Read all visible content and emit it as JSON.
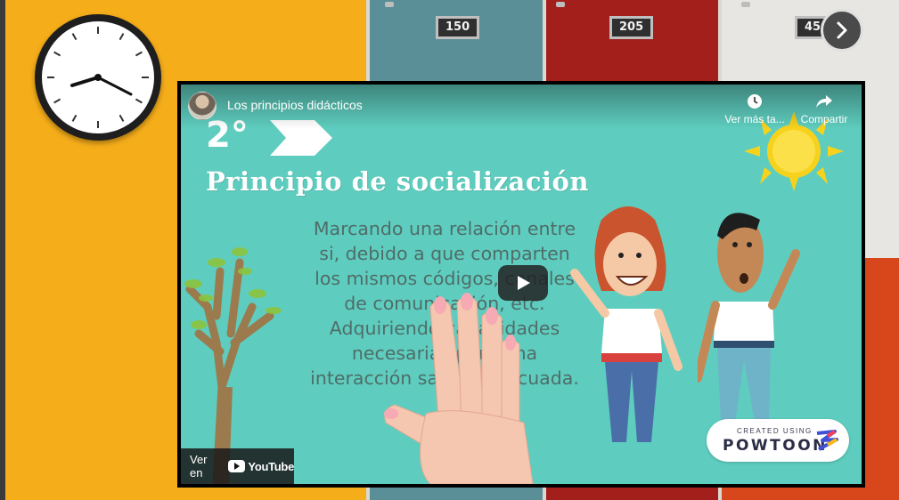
{
  "background": {
    "door_numbers": [
      "150",
      "205",
      "450"
    ],
    "colors": {
      "yellow": "#f5ad1a",
      "teal": "#5b8f98",
      "red": "#a31f1c",
      "orange": "#d8461c"
    }
  },
  "clock": {
    "icon": "wall-clock-icon",
    "time": "8:20"
  },
  "navigation": {
    "next_icon": "chevron-right-icon"
  },
  "video": {
    "title": "Los principios didácticos",
    "actions": {
      "watch_later": "Ver más ta...",
      "share": "Compartir"
    },
    "slide": {
      "number": "2°",
      "heading": "Principio de socialización",
      "body_lines": [
        "Marcando una relación entre",
        "si, debido a que comparten",
        "los mismos códigos, canales",
        "de comunicación, etc.",
        "Adquiriendo capacidades",
        "necesarias para una",
        "interacción sana y adecuada."
      ]
    },
    "watermark": {
      "created_using": "CREATED USING",
      "brand": "POWTOON"
    },
    "watch_on": {
      "label": "Ver en",
      "logo_text": "YouTube"
    },
    "colors": {
      "slide_bg": "#5ecdbf",
      "sun": "#f7d21c"
    }
  }
}
